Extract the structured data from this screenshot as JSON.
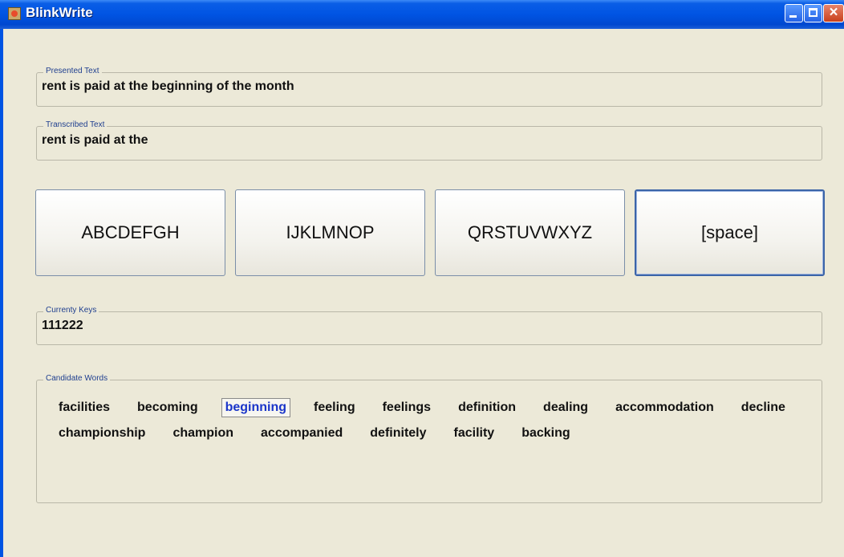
{
  "window": {
    "title": "BlinkWrite"
  },
  "presented": {
    "label": "Presented Text",
    "value": "rent is paid at the beginning of the month"
  },
  "transcribed": {
    "label": "Transcribed Text",
    "value": "rent is paid at the"
  },
  "keys": [
    {
      "label": "ABCDEFGH",
      "focused": false
    },
    {
      "label": "IJKLMNOP",
      "focused": false
    },
    {
      "label": "QRSTUVWXYZ",
      "focused": false
    },
    {
      "label": "[space]",
      "focused": true
    }
  ],
  "current_keys": {
    "label": "Currenty Keys",
    "value": "111222"
  },
  "candidates": {
    "label": "Candidate Words",
    "selected": "beginning",
    "rows": [
      [
        "facilities",
        "becoming",
        "beginning",
        "feeling",
        "feelings",
        "definition",
        "dealing",
        "accommodation",
        "decline"
      ],
      [
        "championship",
        "champion",
        "accompanied",
        "definitely",
        "facility",
        "backing"
      ]
    ]
  },
  "colors": {
    "titlebar": "#0054e3",
    "background": "#ece9d8",
    "selected_word": "#1a35c9",
    "group_title": "#1f3f8f"
  }
}
